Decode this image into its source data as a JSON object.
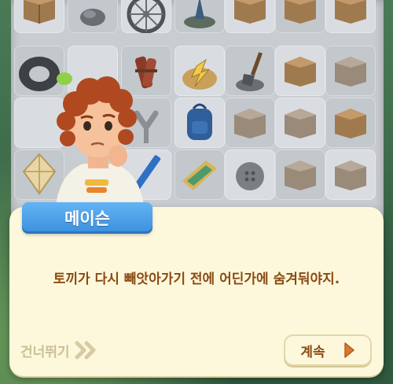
{
  "dialog": {
    "speaker_name": "메이슨",
    "message": "토끼가 다시 빼앗아가기 전에 어딘가에 숨겨둬야지.",
    "skip_label": "건너뛰기",
    "continue_label": "계속"
  },
  "board": {
    "items": [
      {
        "name": "crate-item"
      },
      {
        "name": "rock-item"
      },
      {
        "name": "wheel-item"
      },
      {
        "name": "weed-item"
      },
      {
        "name": "crate-item"
      },
      {
        "name": "crate-item"
      },
      {
        "name": "crate-item"
      },
      {
        "name": "tire-item"
      },
      {
        "name": "firewood-item"
      },
      {
        "name": "trinkets-item"
      },
      {
        "name": "shovel-item"
      },
      {
        "name": "crate-item"
      },
      {
        "name": "crate-item"
      },
      {
        "name": "slingshot-item"
      },
      {
        "name": "backpack-item"
      },
      {
        "name": "crate-item"
      },
      {
        "name": "crate-item"
      },
      {
        "name": "crate-item"
      },
      {
        "name": "kite-item"
      },
      {
        "name": "pencil-item"
      },
      {
        "name": "map-item"
      },
      {
        "name": "button-item"
      },
      {
        "name": "crate-item"
      },
      {
        "name": "crate-item"
      }
    ]
  },
  "colors": {
    "name_tag": "#3b8fde",
    "message_text": "#8a4a12",
    "skip_text": "#cbbf97",
    "dialog_bg": "#fdf8dc"
  }
}
